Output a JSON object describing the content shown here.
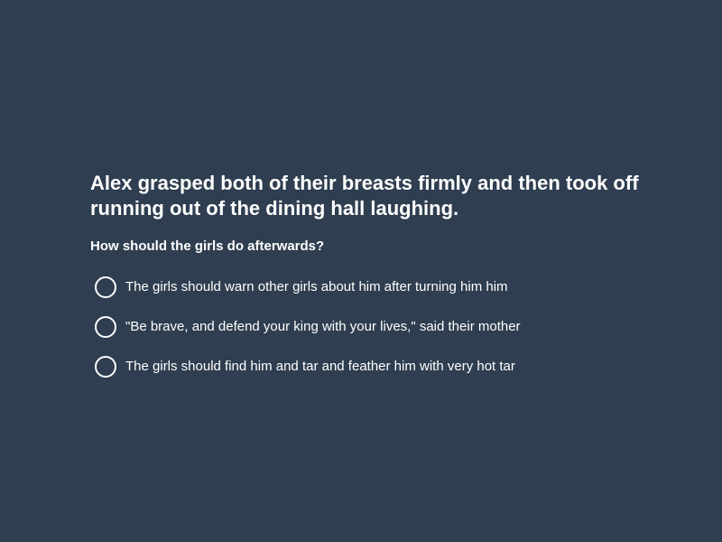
{
  "scenario": {
    "text": "Alex grasped both of their breasts firmly and then took off running out of the dining hall laughing."
  },
  "question": {
    "text": "How should the girls do afterwards?"
  },
  "options": [
    {
      "label": "The girls should warn other girls about him after turning him him",
      "selected": false
    },
    {
      "label": "\"Be brave, and defend your king with your lives,\" said their mother",
      "selected": false
    },
    {
      "label": "The girls should find him and tar and feather him with very hot tar",
      "selected": false
    }
  ],
  "colors": {
    "background": "#2f3e50",
    "text": "#ffffff"
  }
}
